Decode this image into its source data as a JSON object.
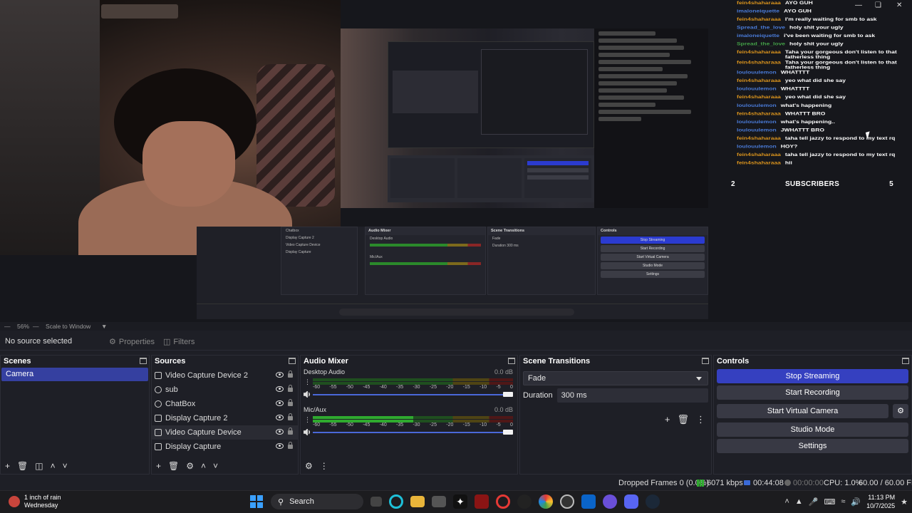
{
  "chat": {
    "lines": [
      {
        "user": "fein4shaharaaa",
        "msg": "AYO GUH",
        "color": "orange"
      },
      {
        "user": "imaloneiquette",
        "msg": "AYO GUH",
        "color": "blue"
      },
      {
        "user": "fein4shaharaaa",
        "msg": "I'm really waiting for smb to ask",
        "color": "orange"
      },
      {
        "user": "Spread_the_love",
        "msg": "holy shit your ugly",
        "color": "blue"
      },
      {
        "user": "imaloneiquette",
        "msg": "i've been waiting for smb to ask",
        "color": "blue"
      },
      {
        "user": "Spread_the_love",
        "msg": "holy shit your ugly",
        "color": "green"
      },
      {
        "user": "fein4shaharaaa",
        "msg": "Taha your gorgeous don't listen to that fatherless thing",
        "color": "orange"
      },
      {
        "user": "fein4shaharaaa",
        "msg": "Taha your gorgeous don't listen to that fatherless thing",
        "color": "orange"
      },
      {
        "user": "loulouulemon",
        "msg": "WHATTTT",
        "color": "blue"
      },
      {
        "user": "fein4shaharaaa",
        "msg": "yeo what did she say",
        "color": "orange"
      },
      {
        "user": "loulouulemon",
        "msg": "WHATTTT",
        "color": "blue"
      },
      {
        "user": "fein4shaharaaa",
        "msg": "yeo what did she say",
        "color": "orange"
      },
      {
        "user": "loulouulemon",
        "msg": "what's happening",
        "color": "blue"
      },
      {
        "user": "fein4shaharaaa",
        "msg": "WHATTT BRO",
        "color": "orange"
      },
      {
        "user": "loulouulemon",
        "msg": "what's happening..",
        "color": "blue"
      },
      {
        "user": "loulouulemon",
        "msg": "JWHATTT BRO",
        "color": "blue"
      },
      {
        "user": "fein4shaharaaa",
        "msg": "taha tell jazzy to respond to my text rq",
        "color": "orange"
      },
      {
        "user": "loulouulemon",
        "msg": "HOY?",
        "color": "blue"
      },
      {
        "user": "fein4shaharaaa",
        "msg": "taha tell jazzy to respond to my text rq",
        "color": "orange"
      },
      {
        "user": "fein4shaharaaa",
        "msg": "hii",
        "color": "orange"
      }
    ],
    "subs_left": "2",
    "subs_label": "SUBSCRIBERS",
    "subs_right": "5"
  },
  "zoom": {
    "percent": "56%",
    "mode": "Scale to Window"
  },
  "toolbar": {
    "no_source": "No source selected",
    "properties": "Properties",
    "filters": "Filters"
  },
  "scenes": {
    "title": "Scenes",
    "items": [
      "Camera"
    ]
  },
  "sources": {
    "title": "Sources",
    "items": [
      {
        "name": "Video Capture Device 2",
        "icon": "camera-icon"
      },
      {
        "name": "sub",
        "icon": "globe-icon"
      },
      {
        "name": "ChatBox",
        "icon": "globe-icon"
      },
      {
        "name": "Display Capture 2",
        "icon": "monitor-icon"
      },
      {
        "name": "Video Capture Device",
        "icon": "camera-icon"
      },
      {
        "name": "Display Capture",
        "icon": "monitor-icon"
      }
    ]
  },
  "mixer": {
    "title": "Audio Mixer",
    "channels": [
      {
        "name": "Desktop Audio",
        "db": "0.0 dB",
        "level": 0.0
      },
      {
        "name": "Mic/Aux",
        "db": "0.0 dB",
        "level": 0.5
      }
    ],
    "ticks": [
      "-60",
      "-55",
      "-50",
      "-45",
      "-40",
      "-35",
      "-30",
      "-25",
      "-20",
      "-15",
      "-10",
      "-5",
      "0"
    ]
  },
  "transitions": {
    "title": "Scene Transitions",
    "selected": "Fade",
    "duration_label": "Duration",
    "duration_value": "300 ms"
  },
  "controls": {
    "title": "Controls",
    "stop_streaming": "Stop Streaming",
    "start_recording": "Start Recording",
    "start_virtual_camera": "Start Virtual Camera",
    "studio_mode": "Studio Mode",
    "settings": "Settings"
  },
  "status": {
    "dropped": "Dropped Frames 0 (0.0%)",
    "kbps": "6071 kbps",
    "stream_time": "00:44:08",
    "rec_time": "00:00:00",
    "cpu": "CPU: 1.0%",
    "fps": "60.00 / 60.00 FPS"
  },
  "taskbar": {
    "weather_title": "1 inch of rain",
    "weather_day": "Wednesday",
    "search": "Search",
    "time": "11:13 PM",
    "date": "10/7/2025"
  },
  "colors": {
    "accent": "#3540c0",
    "username": "#d9931d",
    "meter_green": "#2faa2f"
  }
}
